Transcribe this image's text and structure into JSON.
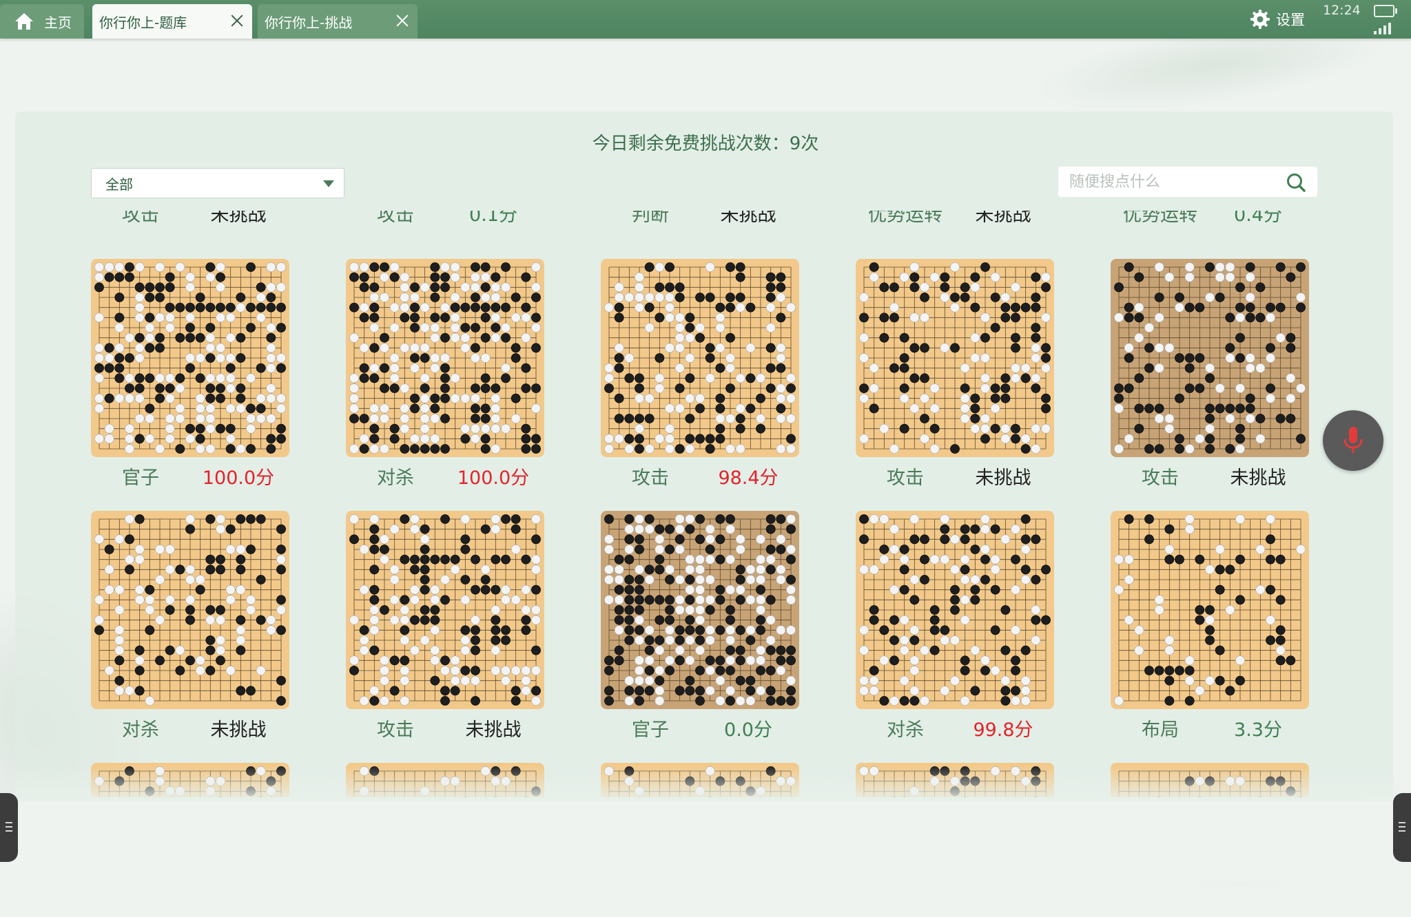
{
  "tabs": {
    "home": "主页",
    "tab1": "你行你上-题库",
    "tab2": "你行你上-挑战"
  },
  "status": {
    "time": "12:24",
    "settings": "设置"
  },
  "quota": "今日剩余免费挑战次数：9次",
  "filter": {
    "selected": "全部"
  },
  "search": {
    "placeholder": "随便搜点什么"
  },
  "partial_row": [
    {
      "category": "攻击",
      "result": "未挑战"
    },
    {
      "category": "攻击",
      "result": "0.1分"
    },
    {
      "category": "判断",
      "result": "未挑战"
    },
    {
      "category": "优势运转",
      "result": "未挑战"
    },
    {
      "category": "优势运转",
      "result": "0.4分"
    }
  ],
  "rows": [
    [
      {
        "category": "官子",
        "result": "100.0分",
        "scored": true
      },
      {
        "category": "对杀",
        "result": "100.0分",
        "scored": true
      },
      {
        "category": "攻击",
        "result": "98.4分",
        "scored": true
      },
      {
        "category": "攻击",
        "result": "未挑战",
        "scored": false
      },
      {
        "category": "攻击",
        "result": "未挑战",
        "scored": false
      }
    ],
    [
      {
        "category": "对杀",
        "result": "未挑战",
        "scored": false
      },
      {
        "category": "攻击",
        "result": "未挑战",
        "scored": false
      },
      {
        "category": "官子",
        "result": "0.0分",
        "scored": false
      },
      {
        "category": "对杀",
        "result": "99.8分",
        "scored": true
      },
      {
        "category": "布局",
        "result": "3.3分",
        "scored": false
      }
    ]
  ],
  "colors": {
    "accent": "#4e8460",
    "score_high": "#e2232a",
    "score_low": "#3f7f52",
    "category": "#4a7a58",
    "unchallenged": "#222222",
    "board": "#f2c98a",
    "board_dim": "#c7a376"
  },
  "icons": [
    "home-icon",
    "close-icon",
    "gear-icon",
    "search-icon",
    "microphone-icon",
    "dropdown-caret-icon"
  ]
}
